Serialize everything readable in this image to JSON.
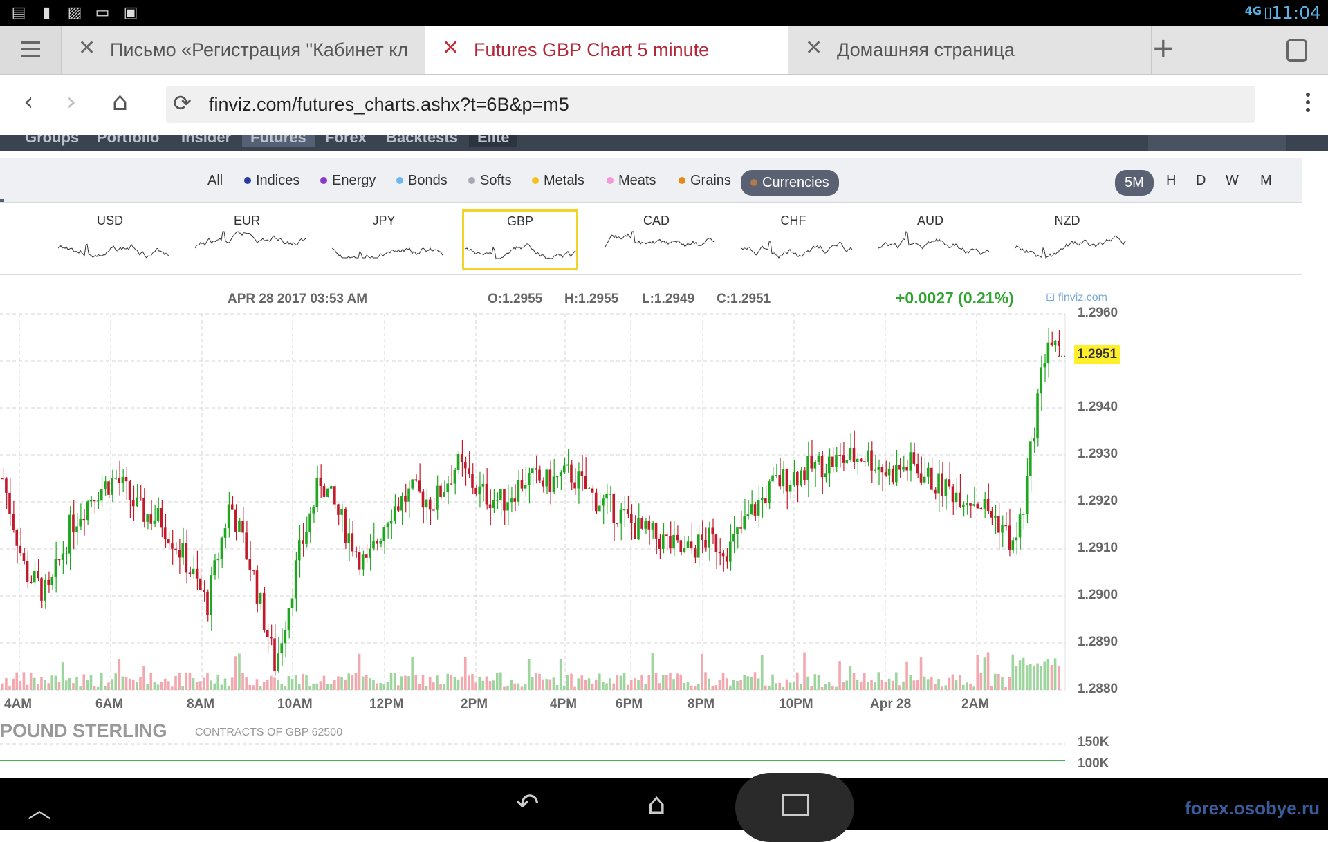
{
  "status": {
    "time": "11:04",
    "network": "4G"
  },
  "tabs": [
    {
      "title": "Письмо «Регистрация \"Кабинет кл",
      "active": false
    },
    {
      "title": "Futures GBP Chart 5 minute",
      "active": true
    },
    {
      "title": "Домашняя страница",
      "active": false
    }
  ],
  "address": {
    "url": "finviz.com/futures_charts.ashx?t=6B&p=m5"
  },
  "site_nav": [
    "Groups",
    "Portfolio",
    "Insider",
    "Futures",
    "Forex",
    "Backtests",
    "Elite"
  ],
  "filters": {
    "items": [
      {
        "label": "All",
        "color": ""
      },
      {
        "label": "Indices",
        "color": "#2b3a9c"
      },
      {
        "label": "Energy",
        "color": "#8a3ac6"
      },
      {
        "label": "Bonds",
        "color": "#6db6ef"
      },
      {
        "label": "Softs",
        "color": "#a8a8b4"
      },
      {
        "label": "Metals",
        "color": "#f2c21e"
      },
      {
        "label": "Meats",
        "color": "#f29ad6"
      },
      {
        "label": "Grains",
        "color": "#e08a1a"
      },
      {
        "label": "Currencies",
        "color": "#b07a4a"
      }
    ],
    "selected": "Currencies",
    "timeframes": [
      "5M",
      "H",
      "D",
      "W",
      "M"
    ],
    "timeframe_selected": "5M"
  },
  "currencies": [
    "USD",
    "EUR",
    "JPY",
    "GBP",
    "CAD",
    "CHF",
    "AUD",
    "NZD"
  ],
  "selected_currency": "GBP",
  "quote": {
    "date": "APR 28 2017 03:53 AM",
    "open": "O:1.2955",
    "high": "H:1.2955",
    "low": "L:1.2949",
    "close": "C:1.2951",
    "change": "+0.0027 (0.21%)",
    "brand": "finviz.com",
    "last": "1.2951"
  },
  "chart_data": {
    "type": "candlestick",
    "y_ticks": [
      "1.2960",
      "1.2950",
      "1.2940",
      "1.2930",
      "1.2920",
      "1.2910",
      "1.2900",
      "1.2890",
      "1.2880"
    ],
    "ylim": [
      1.288,
      1.296
    ],
    "x_ticks": [
      "4AM",
      "6AM",
      "8AM",
      "10AM",
      "12PM",
      "2PM",
      "4PM",
      "6PM",
      "8PM",
      "10PM",
      "Apr 28",
      "2AM"
    ],
    "close_path": [
      [
        0,
        1.2925
      ],
      [
        2,
        1.2905
      ],
      [
        4,
        1.29
      ],
      [
        6,
        1.2915
      ],
      [
        8,
        1.2922
      ],
      [
        10,
        1.2925
      ],
      [
        12,
        1.2918
      ],
      [
        14,
        1.2916
      ],
      [
        16,
        1.2908
      ],
      [
        18,
        1.2898
      ],
      [
        20,
        1.292
      ],
      [
        22,
        1.2905
      ],
      [
        24,
        1.2885
      ],
      [
        26,
        1.2908
      ],
      [
        28,
        1.2925
      ],
      [
        30,
        1.2915
      ],
      [
        32,
        1.2906
      ],
      [
        34,
        1.2918
      ],
      [
        36,
        1.2922
      ],
      [
        38,
        1.292
      ],
      [
        40,
        1.2928
      ],
      [
        42,
        1.2922
      ],
      [
        44,
        1.292
      ],
      [
        46,
        1.2925
      ],
      [
        48,
        1.2924
      ],
      [
        50,
        1.2926
      ],
      [
        52,
        1.2921
      ],
      [
        54,
        1.2918
      ],
      [
        56,
        1.2914
      ],
      [
        58,
        1.2912
      ],
      [
        60,
        1.2909
      ],
      [
        62,
        1.2912
      ],
      [
        64,
        1.291
      ],
      [
        66,
        1.2918
      ],
      [
        68,
        1.2924
      ],
      [
        70,
        1.2926
      ],
      [
        72,
        1.2928
      ],
      [
        74,
        1.2929
      ],
      [
        76,
        1.293
      ],
      [
        78,
        1.2926
      ],
      [
        80,
        1.2928
      ],
      [
        82,
        1.2924
      ],
      [
        84,
        1.2922
      ],
      [
        86,
        1.292
      ],
      [
        88,
        1.2915
      ],
      [
        89,
        1.291
      ],
      [
        90,
        1.292
      ],
      [
        91,
        1.294
      ],
      [
        92,
        1.2955
      ],
      [
        93,
        1.2951
      ]
    ],
    "volume_axis_ticks": [
      "150K",
      "100K"
    ]
  },
  "cot": {
    "title": "POUND STERLING",
    "subtitle": "CONTRACTS OF GBP 62500"
  },
  "watermark": "forex.osobye.ru"
}
